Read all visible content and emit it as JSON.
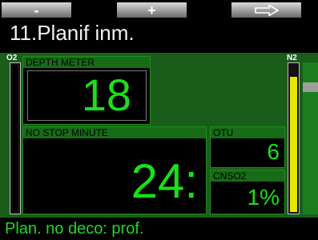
{
  "softkeys": {
    "minus": "-",
    "plus": "+"
  },
  "title": "11.Planif inm.",
  "o2_bar_label": "O2",
  "n2_bar_label": "N2",
  "depth": {
    "header": "DEPTH    METER",
    "value": "18"
  },
  "nostop": {
    "header": "NO STOP    MINUTE",
    "value": "24:"
  },
  "otu": {
    "header": "OTU",
    "value": "6"
  },
  "cns": {
    "header": "CNSO2",
    "value": "1%"
  },
  "footer_text": "Plan. no deco: prof.",
  "levels": {
    "o2": 0.0,
    "n2": 0.92
  },
  "colors": {
    "accent_green": "#19e019",
    "header_green": "#176b17",
    "n2_bar": "#e6e600"
  }
}
